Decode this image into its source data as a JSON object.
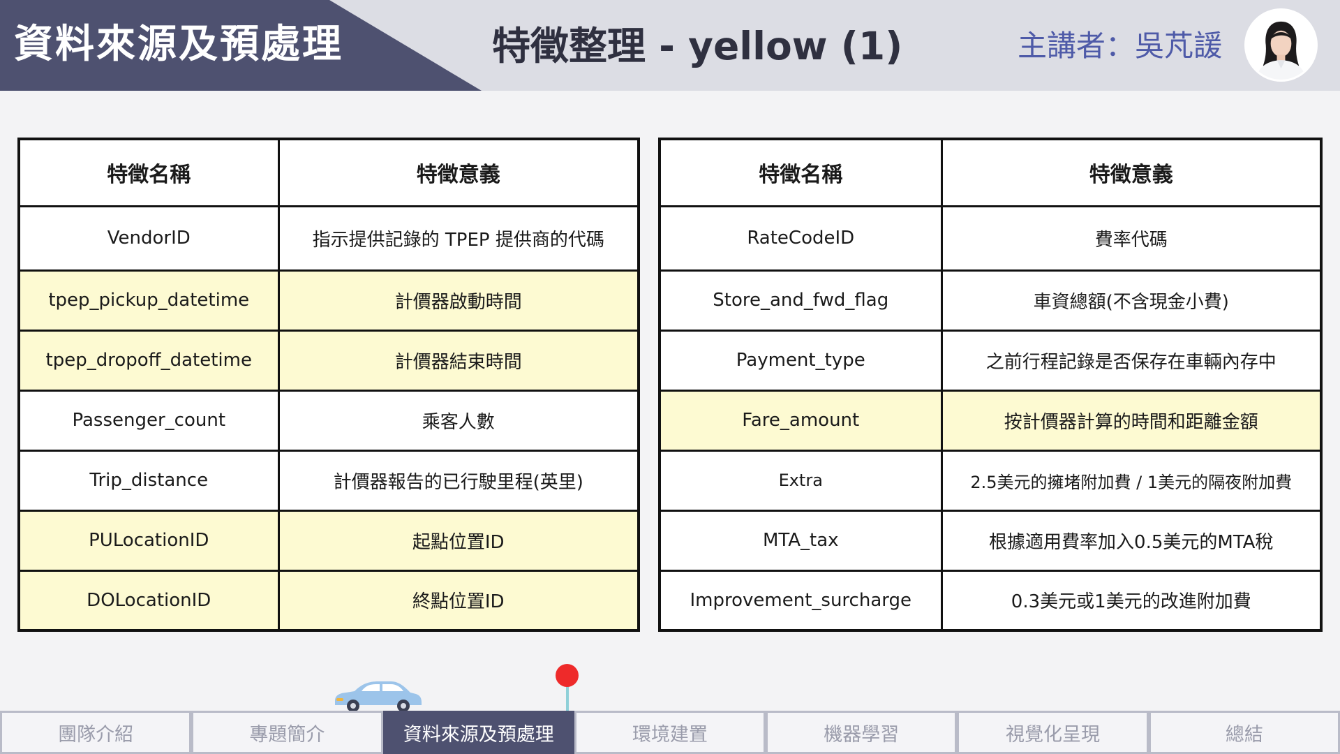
{
  "header": {
    "section_title": "資料來源及預處理",
    "slide_title": "特徵整理  - yellow (1)",
    "speaker": "主講者：吳芃諼"
  },
  "colors": {
    "header_dark": "#4e5170",
    "header_light": "#dcdde4",
    "speaker_text": "#4e5aa8",
    "highlight_row": "#fdfad2",
    "pin": "#ee2a2a",
    "car": "#9cc4ea"
  },
  "icons": [
    "avatar-icon",
    "car-icon",
    "location-pin-icon"
  ],
  "tables": {
    "left": {
      "headers": [
        "特徵名稱",
        "特徵意義"
      ],
      "rows": [
        {
          "name": "VendorID",
          "meaning": "指示提供記錄的 TPEP 提供商的代碼"
        },
        {
          "name": "tpep_pickup_datetime",
          "meaning": "計價器啟動時間"
        },
        {
          "name": "tpep_dropoff_datetime",
          "meaning": "計價器結束時間"
        },
        {
          "name": "Passenger_count",
          "meaning": "乘客人數"
        },
        {
          "name": "Trip_distance",
          "meaning": "計價器報告的已行駛里程(英里)"
        },
        {
          "name": "PULocationID",
          "meaning": "起點位置ID"
        },
        {
          "name": "DOLocationID",
          "meaning": "終點位置ID"
        }
      ]
    },
    "right": {
      "headers": [
        "特徵名稱",
        "特徵意義"
      ],
      "rows": [
        {
          "name": "RateCodeID",
          "meaning": "費率代碼"
        },
        {
          "name": "Store_and_fwd_flag",
          "meaning": "車資總額(不含現金小費)"
        },
        {
          "name": "Payment_type",
          "meaning": "之前行程記錄是否保存在車輛內存中"
        },
        {
          "name": "Fare_amount",
          "meaning": "按計價器計算的時間和距離金額"
        },
        {
          "name": "Extra",
          "meaning": "2.5美元的擁堵附加費 / 1美元的隔夜附加費"
        },
        {
          "name": "MTA_tax",
          "meaning": "根據適用費率加入0.5美元的MTA稅"
        },
        {
          "name": "Improvement_surcharge",
          "meaning": "0.3美元或1美元的改進附加費"
        }
      ]
    }
  },
  "nav": {
    "tabs": [
      "團隊介紹",
      "專題簡介",
      "資料來源及預處理",
      "環境建置",
      "機器學習",
      "視覺化呈現",
      "總結"
    ],
    "active_tab": "資料來源及預處理"
  }
}
